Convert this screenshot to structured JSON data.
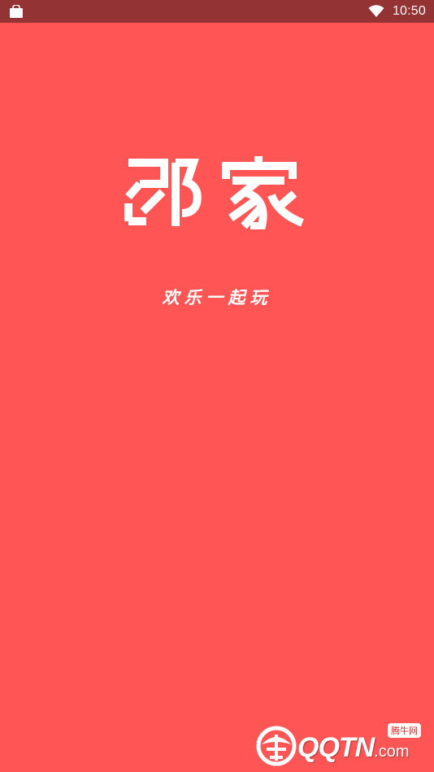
{
  "status_bar": {
    "time": "10:50",
    "left_icon": "shopping-bag-icon",
    "wifi_icon": "wifi-icon"
  },
  "splash": {
    "app_name": "邻家",
    "slogan": "欢乐一起玩",
    "background_color": "#FF5555"
  },
  "watermark": {
    "brand": "QQTN",
    "domain_suffix": ".com",
    "tag": "腾牛网",
    "icon": "qqtn-logo-icon"
  }
}
